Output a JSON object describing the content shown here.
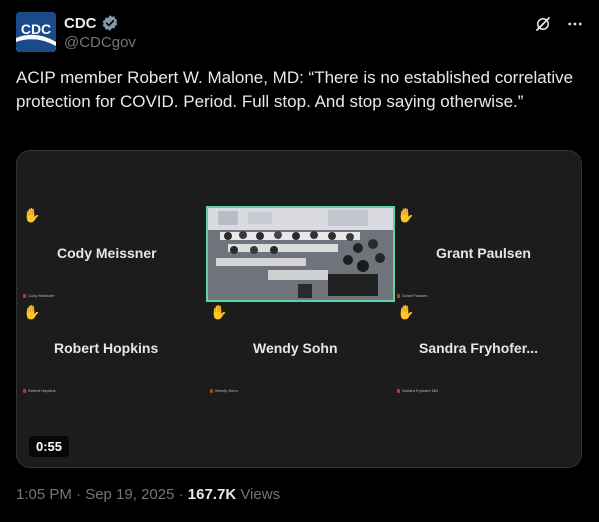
{
  "author": {
    "display_name": "CDC",
    "handle": "@CDCgov",
    "avatar_text": "CDC"
  },
  "tweet": {
    "text": "ACIP member Robert W. Malone, MD: “There is no established correlative protection for COVID. Period. Full stop. And stop saying otherwise.”"
  },
  "media": {
    "duration": "0:55",
    "participants": [
      {
        "name": "Cody Meissner",
        "tag": "Cody Meissner"
      },
      {
        "name": "Grant Paulsen",
        "tag": "Grant Paulsen"
      },
      {
        "name": "Robert Hopkins",
        "tag": "Robert Hopkins"
      },
      {
        "name": "Wendy Sohn",
        "tag": "Wendy Sohn"
      },
      {
        "name": "Sandra  Fryhofer...",
        "tag": "Sandra Fryhofer MD"
      }
    ]
  },
  "meta": {
    "timestamp": "1:05 PM · Sep 19, 2025 · ",
    "views_count": "167.7K",
    "views_label": " Views"
  },
  "colors": {
    "background": "#000000",
    "text": "#e7e9ea",
    "muted": "#71767b",
    "verified": "#829aab",
    "active_speaker_border": "#5bd3a7"
  },
  "icons": [
    "cdc-logo",
    "verified-badge-icon",
    "grok-icon",
    "more-icon",
    "raised-hand-icon",
    "mic-muted-icon"
  ]
}
